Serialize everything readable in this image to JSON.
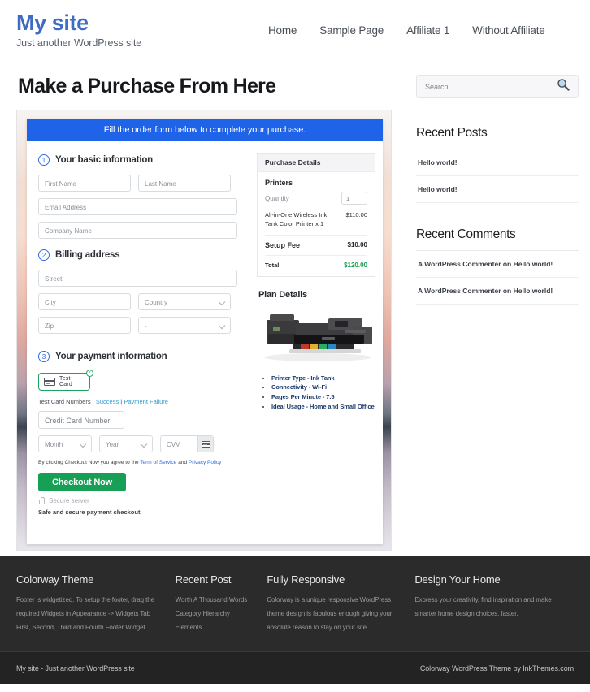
{
  "header": {
    "brand_title": "My site",
    "brand_tagline": "Just another WordPress site",
    "nav": [
      {
        "label": "Home"
      },
      {
        "label": "Sample Page"
      },
      {
        "label": "Affiliate 1"
      },
      {
        "label": "Without Affiliate"
      }
    ]
  },
  "main": {
    "page_title": "Make a Purchase From Here",
    "form": {
      "banner": "Fill the order form below to complete your purchase.",
      "steps": [
        {
          "num": "1",
          "label": "Your basic information"
        },
        {
          "num": "2",
          "label": "Billing address"
        },
        {
          "num": "3",
          "label": "Your payment information"
        }
      ],
      "fields": {
        "first_name": "First Name",
        "last_name": "Last Name",
        "email": "Email Address",
        "company": "Company Name",
        "street": "Street",
        "city": "City",
        "country": "Country",
        "zip": "Zip",
        "state": "-",
        "credit_card": "Credit Card Number",
        "month": "Month",
        "year": "Year",
        "cvv": "CVV"
      },
      "test_card_label": "Test  Card",
      "test_numbers_prefix": "Test Card Numbers : ",
      "test_numbers_success": "Success",
      "test_numbers_sep": " | ",
      "test_numbers_failure": "Payment Failure",
      "agree_prefix": "By clicking Checkout Now you agree to the ",
      "agree_tos": "Term of Service",
      "agree_mid": " and ",
      "agree_privacy": "Privacy Policy",
      "checkout_label": "Checkout Now",
      "secure_server": "Secure server",
      "safe_text": "Safe and secure payment checkout."
    },
    "purchase_details": {
      "title": "Purchase Details",
      "product": "Printers",
      "quantity_label": "Quantity",
      "quantity_value": "1",
      "item_name": "All-in-One Wireless Ink Tank Color Printer x 1",
      "item_price": "$110.00",
      "setup_fee_label": "Setup Fee",
      "setup_fee_value": "$10.00",
      "total_label": "Total",
      "total_value": "$120.00"
    },
    "plan_details": {
      "title": "Plan Details",
      "bullets": [
        "Printer Type - Ink Tank",
        "Connectivity - Wi-Fi",
        "Pages Per Minute - 7.5",
        "Ideal Usage - Home and Small Office"
      ]
    }
  },
  "sidebar": {
    "search_placeholder": "Search",
    "widgets": [
      {
        "title": "Recent Posts",
        "items": [
          "Hello world!",
          "Hello world!"
        ]
      },
      {
        "title": "Recent Comments",
        "items": [
          "A WordPress Commenter on Hello world!",
          "A WordPress Commenter on Hello world!"
        ]
      }
    ]
  },
  "footer": {
    "columns": [
      {
        "title": "Colorway Theme",
        "text": "Footer is widgetized. To setup the footer, drag the required Widgets in Appearance -> Widgets Tab First, Second, Third and Fourth Footer Widget",
        "items": []
      },
      {
        "title": "Recent Post",
        "text": "",
        "items": [
          "Worth A Thousand Words",
          "Category Hierarchy",
          "Elements"
        ]
      },
      {
        "title": "Fully Responsive",
        "text": "Colorway is a unique responsive WordPress theme design is fabulous enough giving your absolute reason to stay on your site.",
        "items": []
      },
      {
        "title": "Design Your Home",
        "text": "Express your creativity, find inspiration and make smarter home design choices, faster.",
        "items": []
      }
    ],
    "copyright_left": "My site - Just another WordPress site",
    "copyright_right": "Colorway WordPress Theme by InkThemes.com"
  },
  "colors": {
    "brand_blue": "#3e6bc4",
    "banner_blue": "#1f63e8",
    "green": "#17a055",
    "total_green": "#17a055",
    "footer_dark": "#2b2b2b",
    "footer_bar": "#232323"
  }
}
